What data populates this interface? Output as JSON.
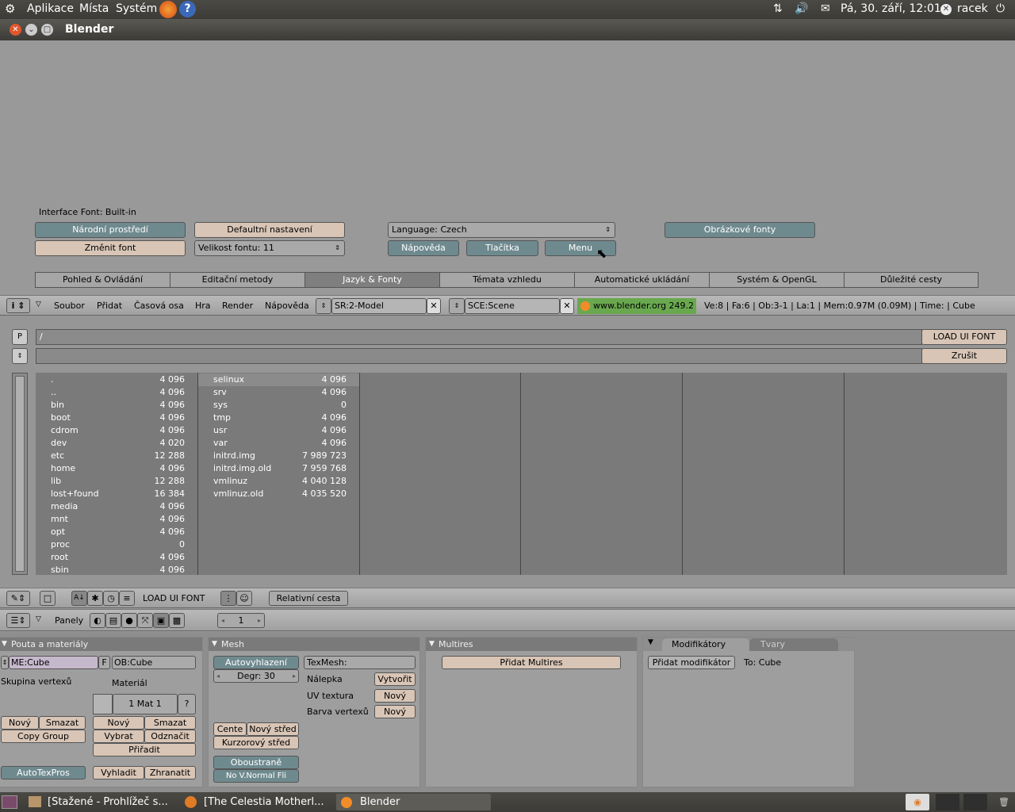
{
  "gnome_panel": {
    "menus": [
      "Aplikace",
      "Místa",
      "Systém"
    ],
    "datetime": "Pá, 30. září, 12:01",
    "user": "racek"
  },
  "window": {
    "title": "Blender"
  },
  "prefs": {
    "interface_font": "Interface Font: Built-in",
    "buttons": {
      "national": "Národní prostředí",
      "default_settings": "Defaultní nastavení",
      "language": "Language:  Czech",
      "image_fonts": "Obrázkové fonty",
      "change_font": "Změnit font",
      "font_size": "Velikost fontu:  11",
      "help": "Nápověda",
      "buttons": "Tlačítka",
      "menu": "Menu"
    },
    "tabs": [
      "Pohled & Ovládání",
      "Editační metody",
      "Jazyk & Fonty",
      "Témata vzhledu",
      "Automatické ukládání",
      "Systém & OpenGL",
      "Důležité cesty"
    ],
    "active_tab": "Jazyk & Fonty"
  },
  "info_header": {
    "menus": [
      "Soubor",
      "Přidat",
      "Časová osa",
      "Hra",
      "Render",
      "Nápověda"
    ],
    "screen": "SR:2-Model",
    "scene": "SCE:Scene",
    "website": "www.blender.org 249.2",
    "stats": "Ve:8 | Fa:6 | Ob:3-1 | La:1  | Mem:0.97M (0.09M)  | Time: | Cube"
  },
  "file_browser": {
    "p_button": "P",
    "path": "/",
    "filename": "",
    "load_button": "LOAD UI FONT",
    "cancel_button": "Zrušit",
    "col1": [
      {
        "name": ".",
        "size": "4 096"
      },
      {
        "name": "..",
        "size": "4 096"
      },
      {
        "name": "bin",
        "size": "4 096"
      },
      {
        "name": "boot",
        "size": "4 096"
      },
      {
        "name": "cdrom",
        "size": "4 096"
      },
      {
        "name": "dev",
        "size": "4 020"
      },
      {
        "name": "etc",
        "size": "12 288"
      },
      {
        "name": "home",
        "size": "4 096"
      },
      {
        "name": "lib",
        "size": "12 288"
      },
      {
        "name": "lost+found",
        "size": "16 384"
      },
      {
        "name": "media",
        "size": "4 096"
      },
      {
        "name": "mnt",
        "size": "4 096"
      },
      {
        "name": "opt",
        "size": "4 096"
      },
      {
        "name": "proc",
        "size": "0"
      },
      {
        "name": "root",
        "size": "4 096"
      },
      {
        "name": "sbin",
        "size": "4 096"
      }
    ],
    "col2": [
      {
        "name": "selinux",
        "size": "4 096"
      },
      {
        "name": "srv",
        "size": "4 096"
      },
      {
        "name": "sys",
        "size": "0"
      },
      {
        "name": "tmp",
        "size": "4 096"
      },
      {
        "name": "usr",
        "size": "4 096"
      },
      {
        "name": "var",
        "size": "4 096"
      },
      {
        "name": "initrd.img",
        "size": "7 989 723"
      },
      {
        "name": "initrd.img.old",
        "size": "7 959 768"
      },
      {
        "name": "vmlinuz",
        "size": "4 040 128"
      },
      {
        "name": "vmlinuz.old",
        "size": "4 035 520"
      }
    ],
    "footer_label": "LOAD UI FONT",
    "relative_path": "Relativní cesta"
  },
  "buttons_window": {
    "header_label": "Panely",
    "page": "1",
    "panels": {
      "links": {
        "title": "Pouta a materiály",
        "me": "ME:Cube",
        "f": "F",
        "ob": "OB:Cube",
        "vertex_group": "Skupina vertexů",
        "material": "Materiál",
        "mat": "1 Mat 1",
        "q": "?",
        "new": "Nový",
        "delete": "Smazat",
        "copy_group": "Copy Group",
        "new2": "Nový",
        "delete2": "Smazat",
        "select": "Vybrat",
        "deselect": "Odznačit",
        "assign": "Přiřadit",
        "autotex": "AutoTexPros",
        "smooth": "Vyhladit",
        "flat": "Zhranatit"
      },
      "mesh": {
        "title": "Mesh",
        "autosmooth": "Autovyhlazení",
        "degr": "Degr: 30",
        "texmesh": "TexMesh:",
        "sticky": "Nálepka",
        "create": "Vytvořit",
        "uv": "UV textura",
        "uv_new": "Nový",
        "vcol": "Barva vertexů",
        "vcol_new": "Nový",
        "centre": "Cente",
        "new_centre": "Nový střed",
        "cursor_centre": "Kurzorový střed",
        "double": "Oboustraně",
        "no_vnormal": "No V.Normal Fli"
      },
      "multires": {
        "title": "Multires",
        "add": "Přidat Multires"
      },
      "modifiers": {
        "tab1": "Modifikátory",
        "tab2": "Tvary",
        "add": "Přidat modifikátor",
        "to": "To: Cube"
      }
    }
  },
  "taskbar": {
    "tasks": [
      "[Stažené - Prohlížeč s...",
      "[The Celestia Motherl...",
      "Blender"
    ]
  }
}
